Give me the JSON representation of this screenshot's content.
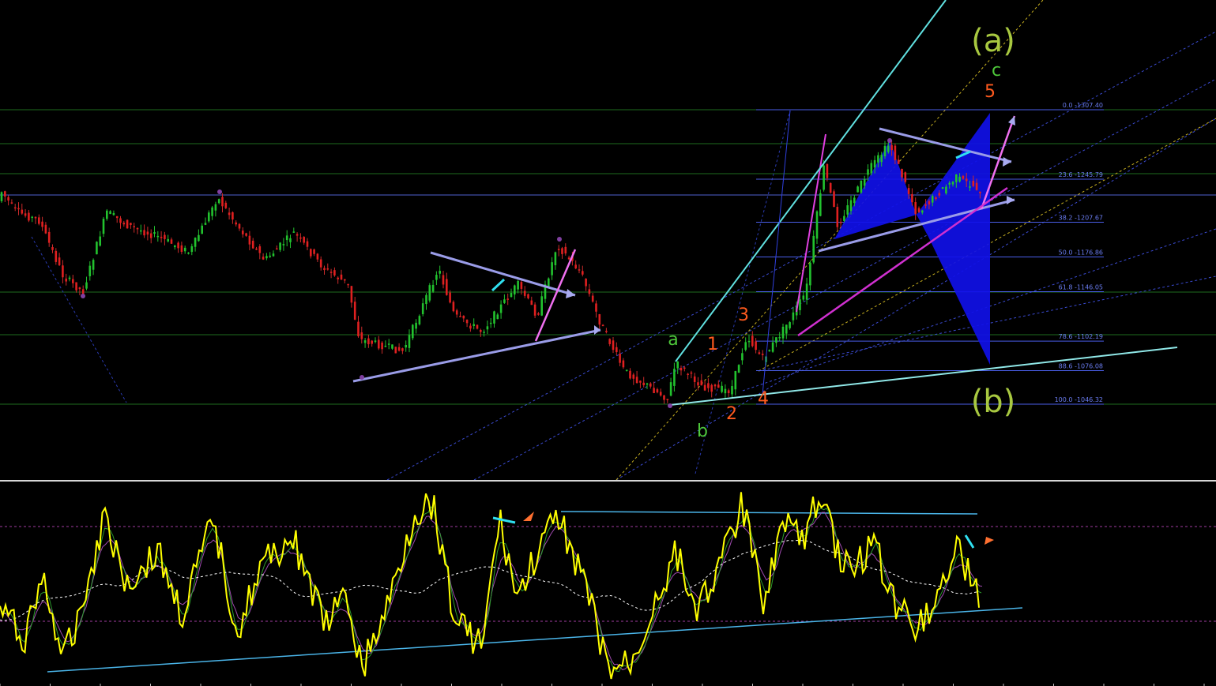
{
  "chart_data": [
    {
      "type": "candlestick",
      "title": "",
      "xlabel": "",
      "ylabel": "",
      "colors": {
        "up": "#22c22e",
        "down": "#e02020",
        "wick": "#cc2b2b"
      },
      "fibonacci": {
        "color": "#4a5ee8",
        "levels": [
          {
            "ratio": 0.0,
            "price": 1307.4,
            "label": "0.0 -1307.40"
          },
          {
            "ratio": 23.6,
            "price": 1245.79,
            "label": "23.6 -1245.79"
          },
          {
            "ratio": 38.2,
            "price": 1207.67,
            "label": "38.2 -1207.67"
          },
          {
            "ratio": 50.0,
            "price": 1176.86,
            "label": "50.0 -1176.86"
          },
          {
            "ratio": 61.8,
            "price": 1146.05,
            "label": "61.8 -1146.05"
          },
          {
            "ratio": 78.6,
            "price": 1102.19,
            "label": "78.6 -1102.19"
          },
          {
            "ratio": 88.6,
            "price": 1076.08,
            "label": "88.6 -1076.08"
          },
          {
            "ratio": 100.0,
            "price": 1046.32,
            "label": "100.0 -1046.32"
          }
        ]
      },
      "wave_labels": {
        "major": [
          {
            "text": "(a)",
            "color": "#a8c840"
          },
          {
            "text": "(b)",
            "color": "#a8c840"
          }
        ],
        "minor": [
          {
            "text": "a",
            "color": "#4ec83a"
          },
          {
            "text": "b",
            "color": "#4ec83a"
          },
          {
            "text": "c",
            "color": "#4ec83a"
          },
          {
            "text": "1",
            "color": "#ff5a1e"
          },
          {
            "text": "2",
            "color": "#ff5a1e"
          },
          {
            "text": "3",
            "color": "#ff5a1e"
          },
          {
            "text": "4",
            "color": "#ff5a1e"
          },
          {
            "text": "5",
            "color": "#ff5a1e"
          }
        ]
      },
      "pattern": "harmonic pattern (blue) with triangle / wedge breakouts"
    },
    {
      "type": "line",
      "title": "",
      "subtitle": "oscillator sub-window",
      "series": [
        {
          "color": "#ffff00",
          "style": "solid"
        },
        {
          "color": "#ffffff",
          "style": "dashed"
        },
        {
          "color": "#2b9a2b",
          "style": "solid"
        },
        {
          "color": "#a04ab0",
          "style": "solid"
        }
      ],
      "levels": [
        {
          "color": "#a03ca0",
          "style": "dashed",
          "position": "upper"
        },
        {
          "color": "#a03ca0",
          "style": "dashed",
          "position": "lower"
        }
      ],
      "trendline_color": "#4ab4e8"
    }
  ]
}
